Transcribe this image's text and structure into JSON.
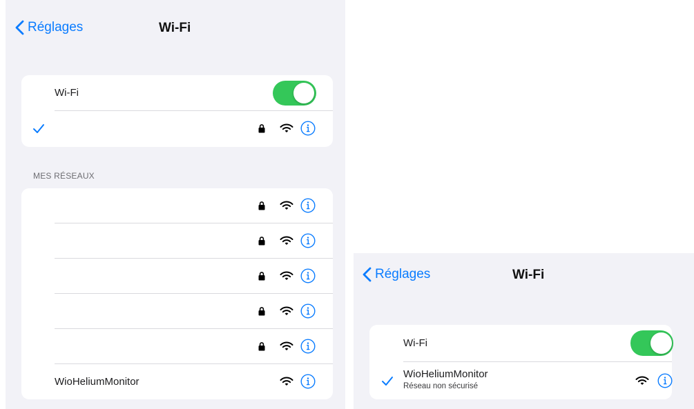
{
  "accent_color": "#0a7cff",
  "toggle_color": "#34c759",
  "panel_a": {
    "nav": {
      "back_label": "Réglages",
      "title": "Wi-Fi"
    },
    "wifi_toggle": {
      "label": "Wi-Fi",
      "on": true
    },
    "connected": {
      "name": "",
      "icons": [
        "checkmark-icon",
        "lock-icon",
        "wifi-icon",
        "info-icon"
      ]
    },
    "my_networks_header": "MES RÉSEAUX",
    "my_networks": [
      {
        "name": "",
        "secured": true
      },
      {
        "name": "",
        "secured": true
      },
      {
        "name": "",
        "secured": true
      },
      {
        "name": "",
        "secured": true
      },
      {
        "name": "",
        "secured": true
      },
      {
        "name": "WioHeliumMonitor",
        "secured": false
      }
    ]
  },
  "panel_b": {
    "nav": {
      "back_label": "Réglages",
      "title": "Wi-Fi"
    },
    "wifi_toggle": {
      "label": "Wi-Fi",
      "on": true
    },
    "connected": {
      "name": "WioHeliumMonitor",
      "subtitle": "Réseau non sécurisé",
      "secured": false
    }
  }
}
